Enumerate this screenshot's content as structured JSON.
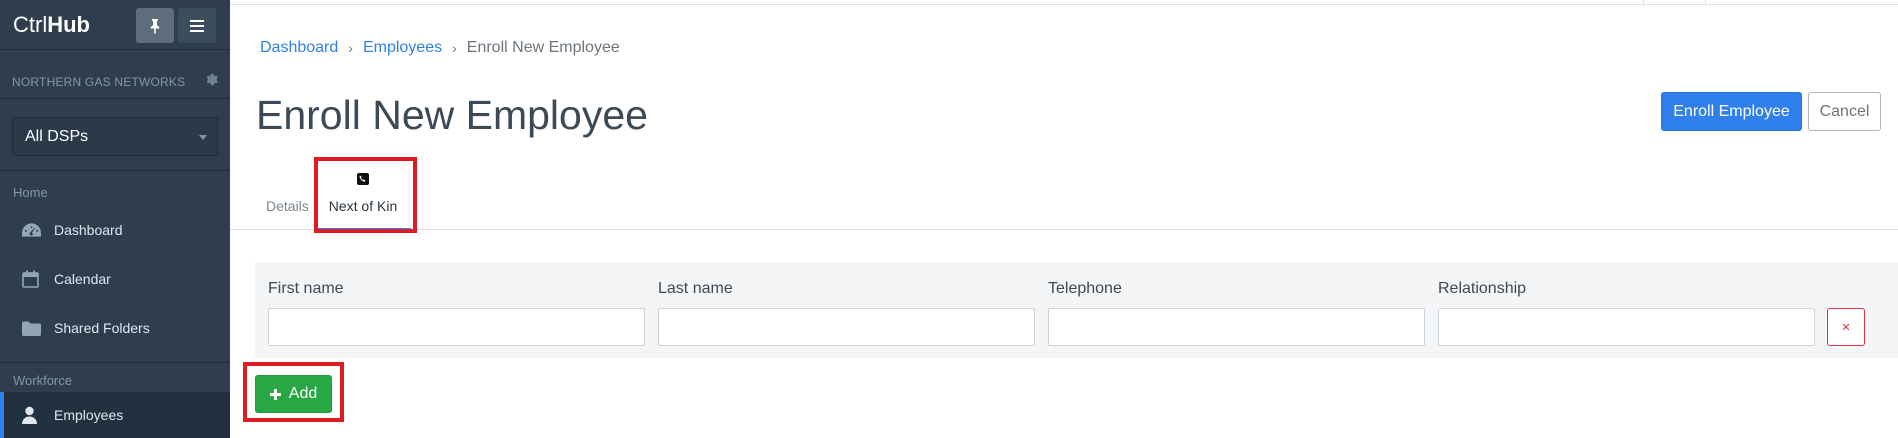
{
  "app": {
    "logo_light": "Ctrl",
    "logo_bold": "Hub"
  },
  "sidebar": {
    "org_name": "NORTHERN GAS NETWORKS",
    "dsp_select_value": "All DSPs",
    "section_home": "Home",
    "section_workforce": "Workforce",
    "items": [
      {
        "label": "Dashboard",
        "icon": "dashboard-icon"
      },
      {
        "label": "Calendar",
        "icon": "calendar-icon"
      },
      {
        "label": "Shared Folders",
        "icon": "folder-icon"
      },
      {
        "label": "Employees",
        "icon": "user-icon",
        "active": true
      }
    ]
  },
  "breadcrumb": {
    "items": [
      "Dashboard",
      "Employees"
    ],
    "current": "Enroll New Employee"
  },
  "page": {
    "title": "Enroll New Employee"
  },
  "actions": {
    "enroll_label": "Enroll Employee",
    "cancel_label": "Cancel"
  },
  "tabs": [
    {
      "label": "Details",
      "active": false
    },
    {
      "label": "Next of Kin",
      "icon": "phone-icon",
      "active": true
    }
  ],
  "next_of_kin": {
    "columns": [
      "First name",
      "Last name",
      "Telephone",
      "Relationship"
    ],
    "row": {
      "first_name": "",
      "last_name": "",
      "telephone": "",
      "relationship": ""
    },
    "remove_symbol": "×",
    "add_label": "Add"
  },
  "colors": {
    "accent": "#2f80ed",
    "success": "#28a745",
    "danger": "#dc3545",
    "highlight": "#e01b24",
    "sidebar_bg": "#2e3e4e"
  }
}
